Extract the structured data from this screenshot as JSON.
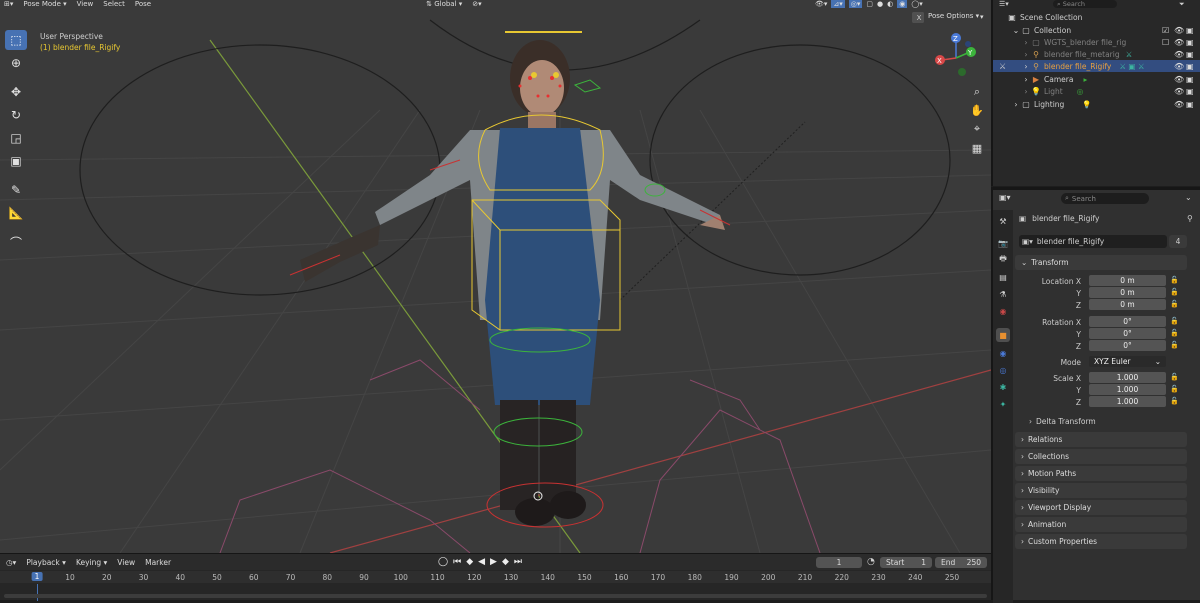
{
  "viewport": {
    "header": {
      "mode": "Pose Mode",
      "menus": [
        "View",
        "Select",
        "Pose"
      ],
      "orientation": "Global",
      "pose_options": "Pose Options",
      "close_label": "X"
    },
    "overlay": {
      "perspective": "User Perspective",
      "object": "(1) blender file_Rigify"
    },
    "gizmo": {
      "x": "X",
      "y": "Y",
      "z": "Z"
    },
    "tools": [
      "select-box-icon",
      "cursor-icon",
      "move-icon",
      "rotate-icon",
      "scale-icon",
      "transform-icon",
      "annotate-icon",
      "measure-icon",
      "relax-icon"
    ]
  },
  "timeline": {
    "menus": [
      "Playback",
      "Keying",
      "View",
      "Marker"
    ],
    "current_frame": "1",
    "start_label": "Start",
    "start_value": "1",
    "end_label": "End",
    "end_value": "250",
    "ticks": [
      "1",
      "10",
      "20",
      "30",
      "40",
      "50",
      "60",
      "70",
      "80",
      "90",
      "100",
      "110",
      "120",
      "130",
      "140",
      "150",
      "160",
      "170",
      "180",
      "190",
      "200",
      "210",
      "220",
      "230",
      "240",
      "250"
    ]
  },
  "outliner": {
    "search_placeholder": "Search",
    "scene_collection": "Scene Collection",
    "rows": [
      {
        "label": "Collection"
      },
      {
        "label": "WGTS_blender file_rig"
      },
      {
        "label": "blender file_metarig"
      },
      {
        "label": "blender file_Rigify"
      },
      {
        "label": "Camera"
      },
      {
        "label": "Light"
      },
      {
        "label": "Lighting"
      }
    ]
  },
  "properties": {
    "search_placeholder": "Search",
    "object_name": "blender file_Rigify",
    "datablock_name": "blender file_Rigify",
    "users": "4",
    "transform_title": "Transform",
    "location": {
      "label_x": "Location X",
      "label_y": "Y",
      "label_z": "Z",
      "x": "0 m",
      "y": "0 m",
      "z": "0 m"
    },
    "rotation": {
      "label_x": "Rotation X",
      "label_y": "Y",
      "label_z": "Z",
      "x": "0°",
      "y": "0°",
      "z": "0°"
    },
    "mode_label": "Mode",
    "mode_value": "XYZ Euler",
    "scale": {
      "label_x": "Scale X",
      "label_y": "Y",
      "label_z": "Z",
      "x": "1.000",
      "y": "1.000",
      "z": "1.000"
    },
    "delta_transform": "Delta Transform",
    "panels": [
      "Relations",
      "Collections",
      "Motion Paths",
      "Visibility",
      "Viewport Display",
      "Animation",
      "Custom Properties"
    ]
  },
  "colors": {
    "accent": "#4772b3",
    "selected_row": "#334d80",
    "rig_yellow": "#e8c832",
    "rig_red": "#c83232",
    "rig_green": "#3cb43c"
  }
}
